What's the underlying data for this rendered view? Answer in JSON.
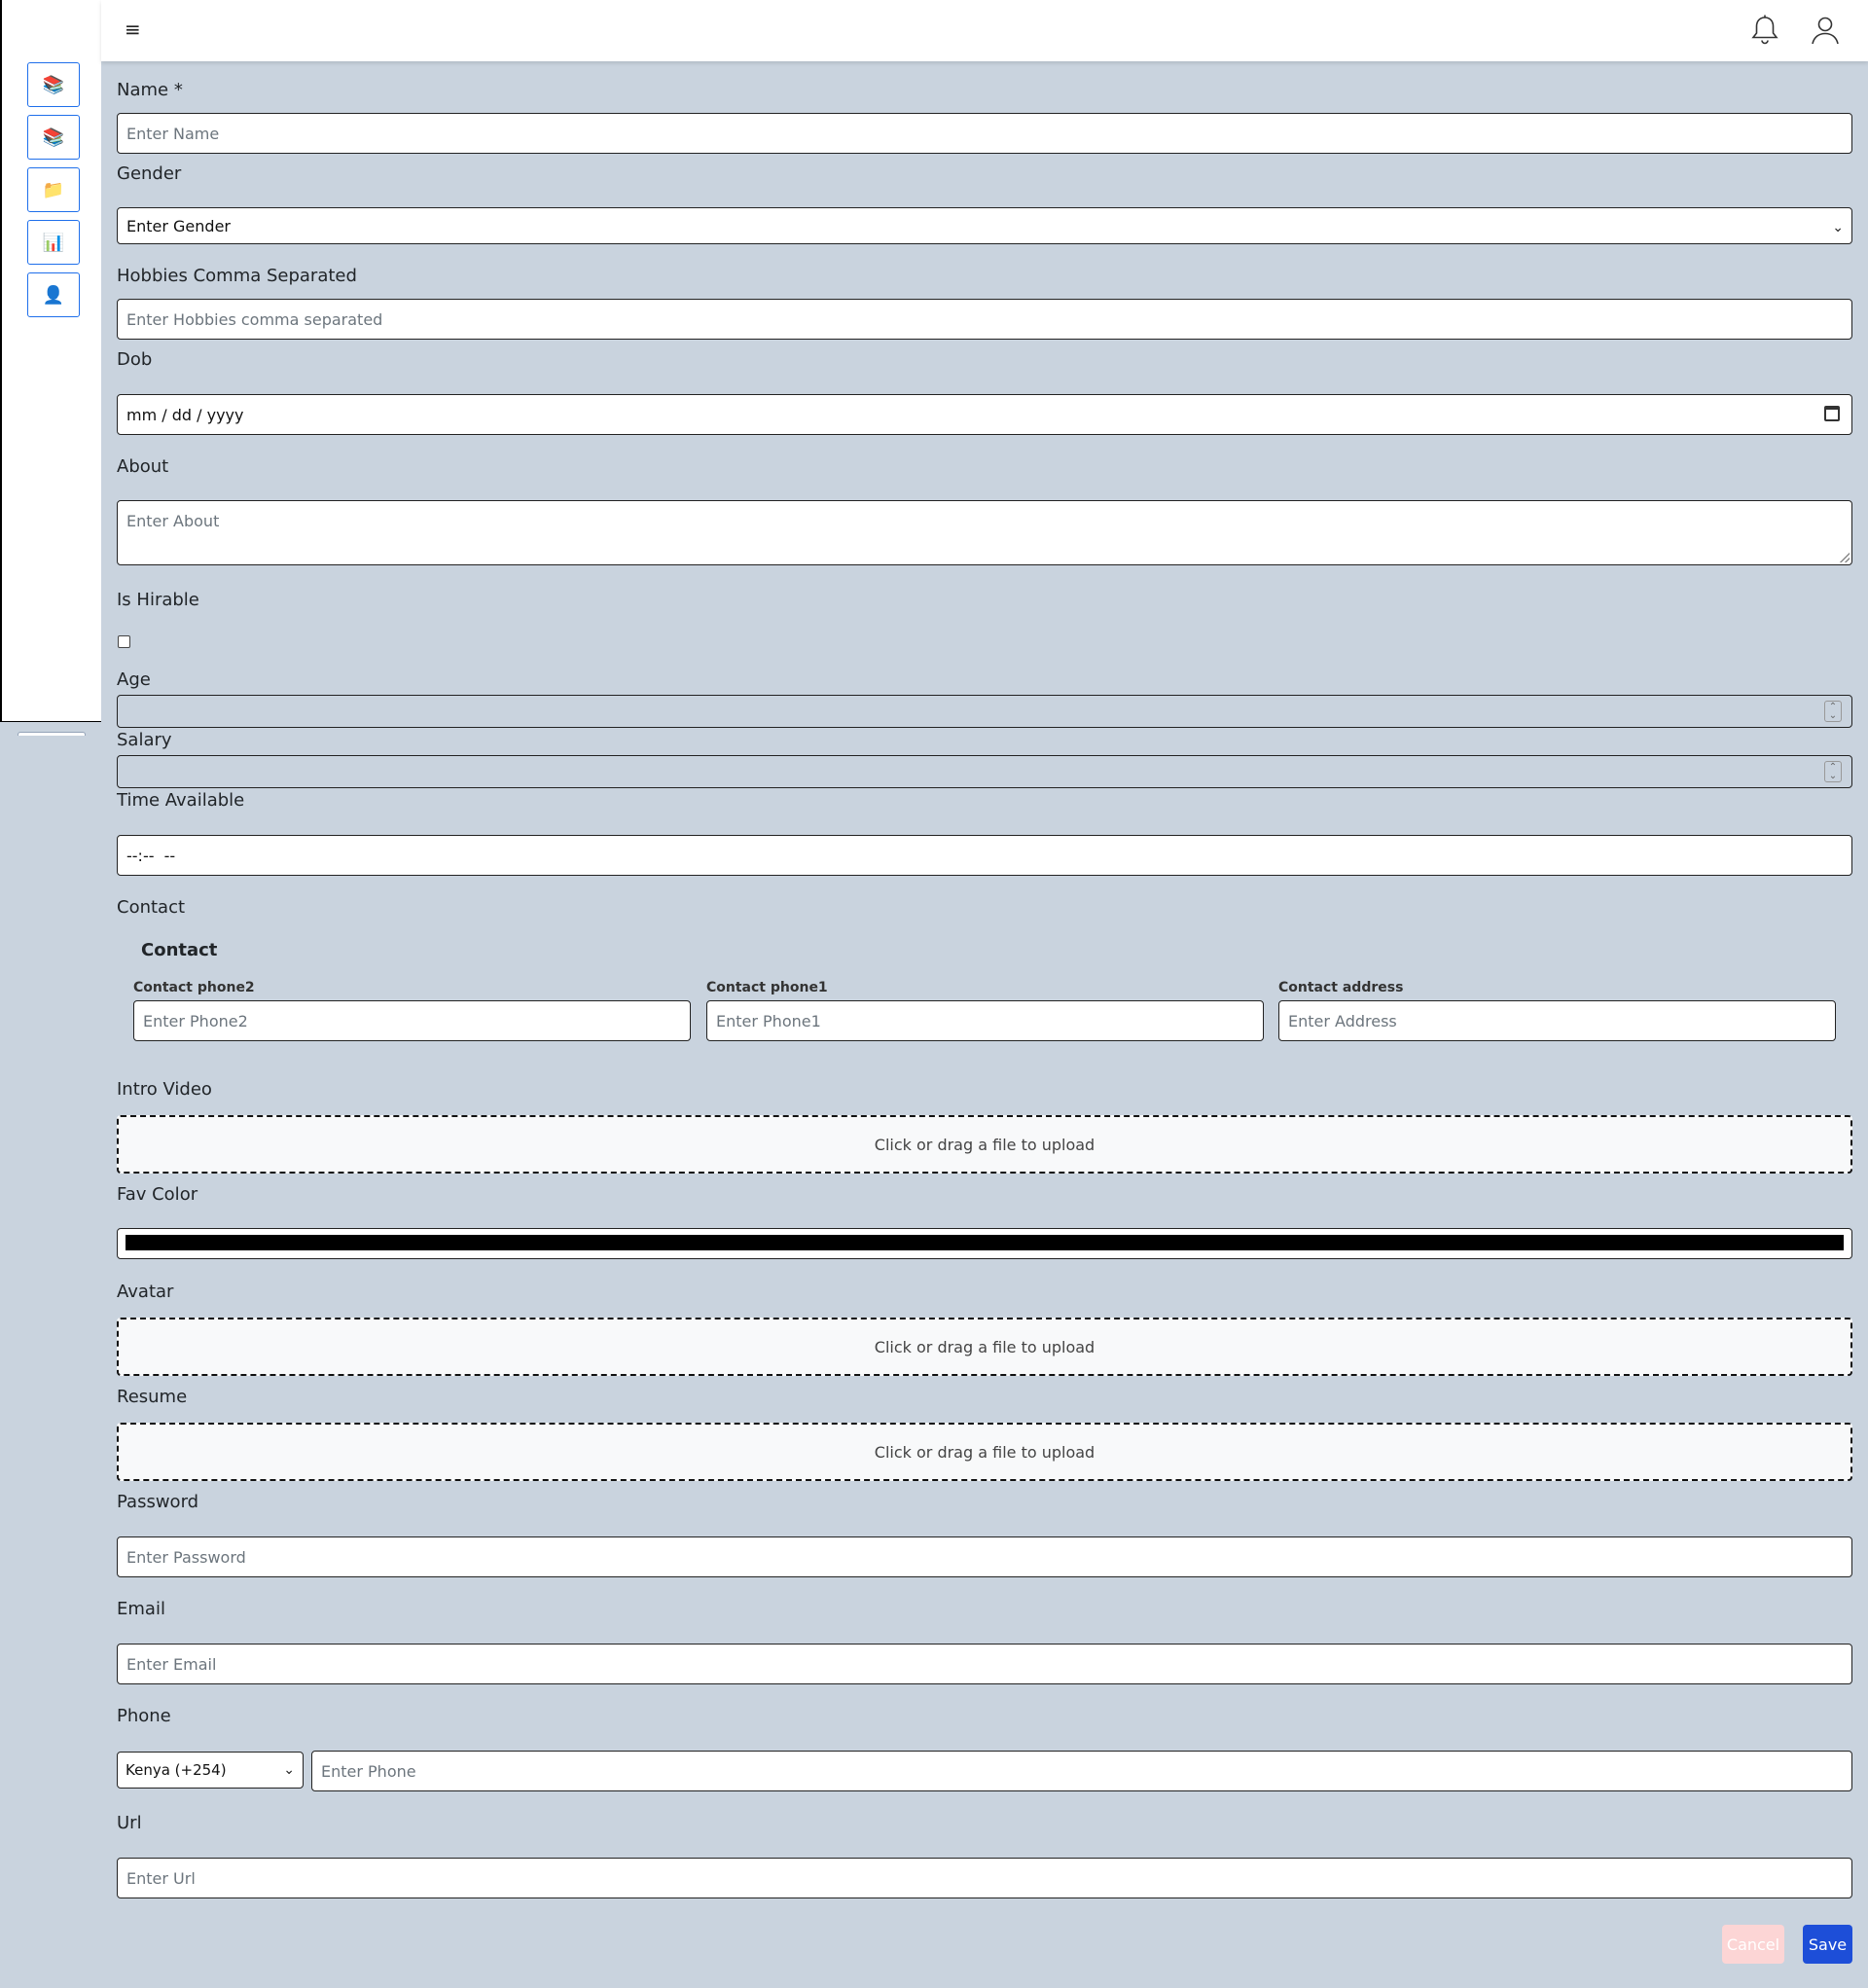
{
  "sidebar": {
    "items": [
      {
        "icon": "books-icon",
        "glyph": "📚"
      },
      {
        "icon": "books-icon",
        "glyph": "📚"
      },
      {
        "icon": "folder-icon",
        "glyph": "📁"
      },
      {
        "icon": "bar-chart-icon",
        "glyph": "📊"
      },
      {
        "icon": "user-icon",
        "glyph": "👤"
      }
    ]
  },
  "topbar": {
    "menu_glyph": "≡",
    "icons": [
      "bell-icon",
      "user-profile-icon"
    ]
  },
  "form": {
    "name": {
      "label": "Name *",
      "placeholder": "Enter Name"
    },
    "gender": {
      "label": "Gender",
      "value": "Enter Gender"
    },
    "hobbies": {
      "label": "Hobbies Comma Separated",
      "placeholder": "Enter Hobbies comma separated"
    },
    "dob": {
      "label": "Dob",
      "value": "mm / dd / yyyy"
    },
    "about": {
      "label": "About",
      "placeholder": "Enter About"
    },
    "is_hirable": {
      "label": "Is Hirable",
      "checked": false
    },
    "age": {
      "label": "Age",
      "value": ""
    },
    "salary": {
      "label": "Salary",
      "value": ""
    },
    "time_available": {
      "label": "Time Available",
      "value": "--:--  --"
    },
    "contact": {
      "label": "Contact",
      "title": "Contact",
      "phone2": {
        "label": "Contact phone2",
        "placeholder": "Enter Phone2"
      },
      "phone1": {
        "label": "Contact phone1",
        "placeholder": "Enter Phone1"
      },
      "address": {
        "label": "Contact address",
        "placeholder": "Enter Address"
      }
    },
    "intro_video": {
      "label": "Intro Video",
      "upload_text": "Click or drag a file to upload"
    },
    "fav_color": {
      "label": "Fav Color",
      "value": "#000000"
    },
    "avatar": {
      "label": "Avatar",
      "upload_text": "Click or drag a file to upload"
    },
    "resume": {
      "label": "Resume",
      "upload_text": "Click or drag a file to upload"
    },
    "password": {
      "label": "Password",
      "placeholder": "Enter Password"
    },
    "email": {
      "label": "Email",
      "placeholder": "Enter Email"
    },
    "phone": {
      "label": "Phone",
      "country": "Kenya (+254)",
      "placeholder": "Enter Phone"
    },
    "url": {
      "label": "Url",
      "placeholder": "Enter Url"
    }
  },
  "actions": {
    "cancel_label": "Cancel",
    "save_label": "Save"
  },
  "colors": {
    "background": "#c9d3de",
    "accent": "#1d4ed8",
    "cancel": "#fcd5d5"
  }
}
